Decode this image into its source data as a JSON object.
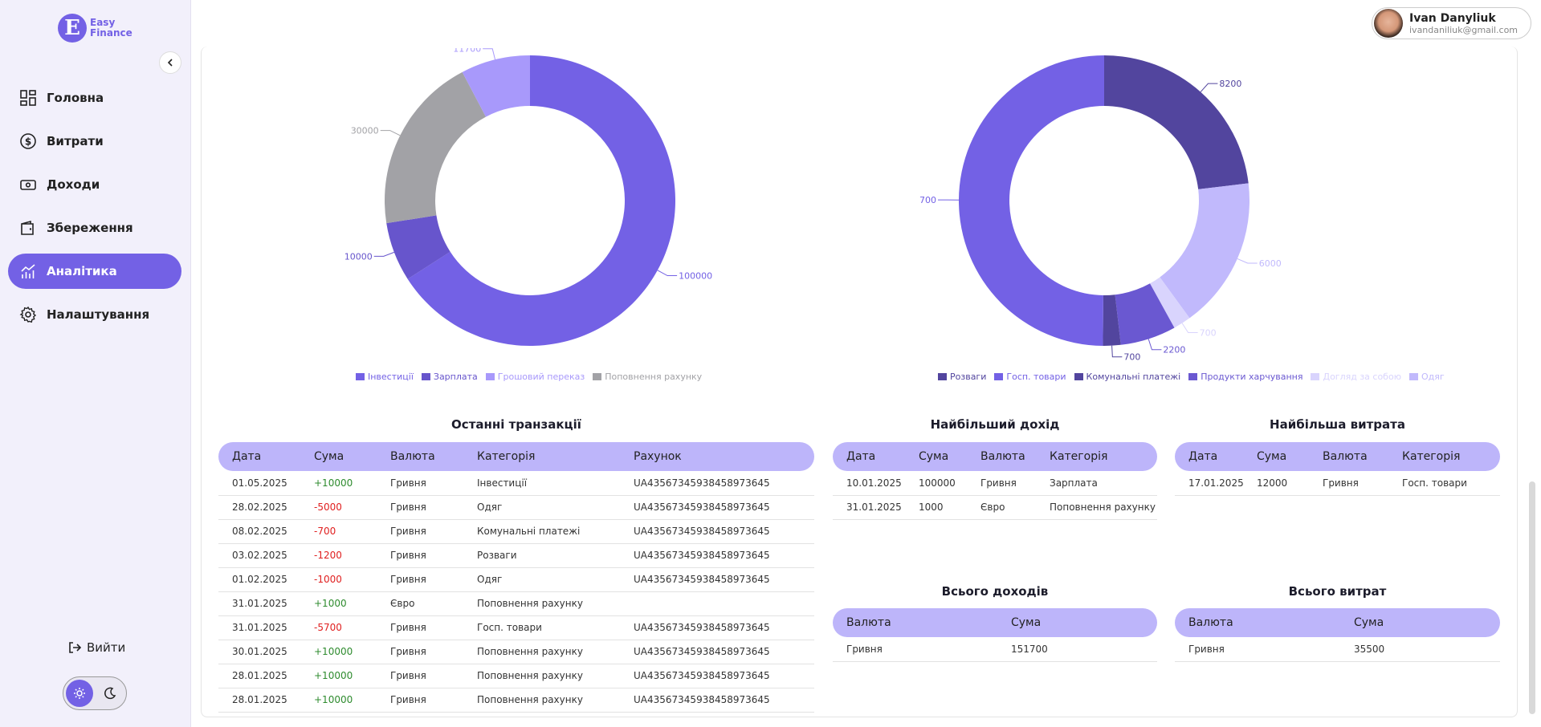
{
  "app": {
    "logo_letter": "E",
    "logo_line1": "Easy",
    "logo_line2": "Finance"
  },
  "nav": [
    {
      "label": "Головна",
      "icon": "dashboard-icon",
      "active": false
    },
    {
      "label": "Витрати",
      "icon": "dollar-icon",
      "active": false
    },
    {
      "label": "Доходи",
      "icon": "cash-icon",
      "active": false
    },
    {
      "label": "Збереження",
      "icon": "wallet-icon",
      "active": false
    },
    {
      "label": "Аналітика",
      "icon": "analytics-icon",
      "active": true
    },
    {
      "label": "Налаштування",
      "icon": "gear-icon",
      "active": false
    }
  ],
  "logout_label": "Вийти",
  "user": {
    "name": "Ivan Danyliuk",
    "email": "ivandaniliuk@gmail.com"
  },
  "colors": {
    "accent": "#7361e5",
    "header_bg": "#bdb5fa",
    "positive": "#2e8b2e",
    "negative": "#e02020"
  },
  "chart_data": [
    {
      "type": "pie",
      "donut": true,
      "slices": [
        {
          "label": "Інвестиції",
          "value": 100000,
          "color": "#7361e5"
        },
        {
          "label": "Зарплата",
          "value": 10000,
          "color": "#6755cc"
        },
        {
          "label": "Поповнення рахунку",
          "value": 30000,
          "color": "#a2a2a6"
        },
        {
          "label": "Грошовий переказ",
          "value": 11700,
          "color": "#a899fb"
        }
      ],
      "legend": [
        {
          "label": "Інвестиції",
          "color": "#7361e5"
        },
        {
          "label": "Зарплата",
          "color": "#6755cc"
        },
        {
          "label": "Грошовий переказ",
          "color": "#a899fb"
        },
        {
          "label": "Поповнення рахунку",
          "color": "#a2a2a6"
        }
      ],
      "legend_position": "bottom"
    },
    {
      "type": "pie",
      "donut": true,
      "slices": [
        {
          "label": "Розваги",
          "value": 8200,
          "color": "#52459e"
        },
        {
          "label": "Одяг",
          "value": 6000,
          "color": "#c1b9fc"
        },
        {
          "label": "Догляд за собою",
          "value": 700,
          "color": "#d9d4fd"
        },
        {
          "label": "Продукти харчування",
          "value": 2200,
          "color": "#6a58d1"
        },
        {
          "label": "Комунальні платежі",
          "value": 700,
          "color": "#52459e"
        },
        {
          "label": "Госп. товари",
          "value": 17700,
          "color": "#7361e5"
        }
      ],
      "legend": [
        {
          "label": "Розваги",
          "color": "#52459e"
        },
        {
          "label": "Госп. товари",
          "color": "#7361e5"
        },
        {
          "label": "Комунальні платежі",
          "color": "#52459e"
        },
        {
          "label": "Продукти харчування",
          "color": "#6a58d1"
        },
        {
          "label": "Догляд за собою",
          "color": "#d9d4fd"
        },
        {
          "label": "Одяг",
          "color": "#c1b9fc"
        }
      ],
      "legend_position": "bottom"
    }
  ],
  "recent": {
    "title": "Останні транзакції",
    "headers": [
      "Дата",
      "Сума",
      "Валюта",
      "Категорія",
      "Рахунок"
    ],
    "rows": [
      [
        "01.05.2025",
        "+10000",
        "Гривня",
        "Інвестиції",
        "UA435673459384589736​45"
      ],
      [
        "28.02.2025",
        "-5000",
        "Гривня",
        "Одяг",
        "UA43567345938458973645"
      ],
      [
        "08.02.2025",
        "-700",
        "Гривня",
        "Комунальні платежі",
        "UA43567345938458973645"
      ],
      [
        "03.02.2025",
        "-1200",
        "Гривня",
        "Розваги",
        "UA43567345938458973645"
      ],
      [
        "01.02.2025",
        "-1000",
        "Гривня",
        "Одяг",
        "UA43567345938458973645"
      ],
      [
        "31.01.2025",
        "+1000",
        "Євро",
        "Поповнення рахунку",
        ""
      ],
      [
        "31.01.2025",
        "-5700",
        "Гривня",
        "Госп. товари",
        "UA43567345938458973645"
      ],
      [
        "30.01.2025",
        "+10000",
        "Гривня",
        "Поповнення рахунку",
        "UA43567345938458973645"
      ],
      [
        "28.01.2025",
        "+10000",
        "Гривня",
        "Поповнення рахунку",
        "UA43567345938458973645"
      ],
      [
        "28.01.2025",
        "+10000",
        "Гривня",
        "Поповнення рахунку",
        "UA43567345938458973645"
      ]
    ]
  },
  "top_income": {
    "title": "Найбільший дохід",
    "headers": [
      "Дата",
      "Сума",
      "Валюта",
      "Категорія"
    ],
    "rows": [
      [
        "10.01.2025",
        "100000",
        "Гривня",
        "Зарплата"
      ],
      [
        "31.01.2025",
        "1000",
        "Євро",
        "Поповнення рахунку"
      ]
    ]
  },
  "top_expense": {
    "title": "Найбільша витрата",
    "headers": [
      "Дата",
      "Сума",
      "Валюта",
      "Категорія"
    ],
    "rows": [
      [
        "17.01.2025",
        "12000",
        "Гривня",
        "Госп. товари"
      ]
    ]
  },
  "total_income": {
    "title": "Всього доходів",
    "headers": [
      "Валюта",
      "Сума"
    ],
    "rows": [
      [
        "Гривня",
        "151700"
      ]
    ]
  },
  "total_expense": {
    "title": "Всього витрат",
    "headers": [
      "Валюта",
      "Сума"
    ],
    "rows": [
      [
        "Гривня",
        "35500"
      ]
    ]
  }
}
